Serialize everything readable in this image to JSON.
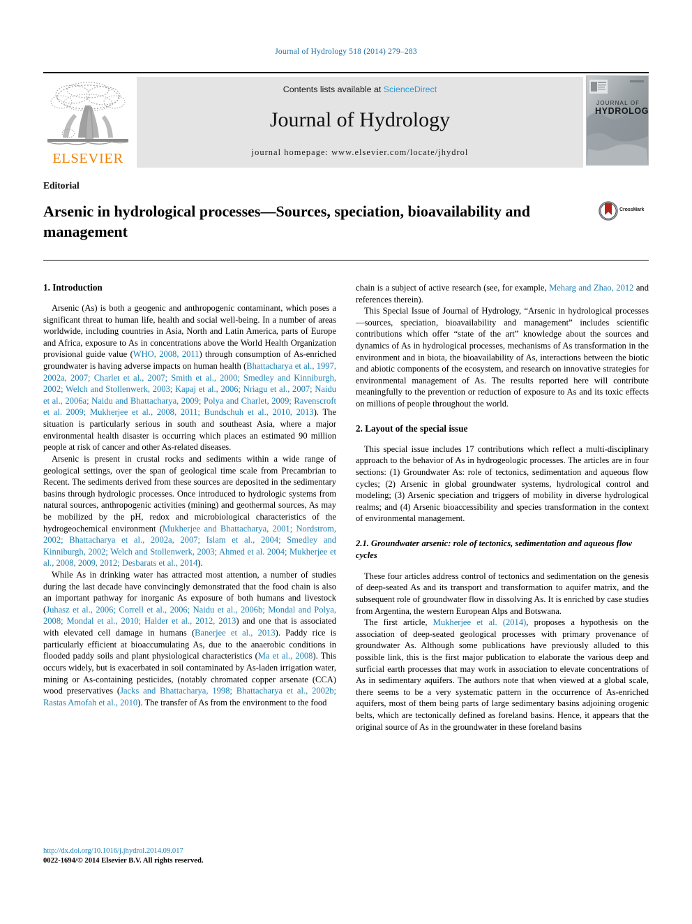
{
  "running_head": "Journal of Hydrology 518 (2014) 279–283",
  "masthead": {
    "publisher_name": "ELSEVIER",
    "publisher_logo_alt": "elsevier-tree-logo",
    "contents_prefix": "Contents lists available at ",
    "contents_link": "ScienceDirect",
    "journal_title": "Journal of Hydrology",
    "homepage_line": "journal homepage: www.elsevier.com/locate/jhydrol",
    "cover_title_line1": "JOURNAL OF",
    "cover_title_line2": "HYDROLOGY"
  },
  "article": {
    "kicker": "Editorial",
    "title": "Arsenic in hydrological processes—Sources, speciation, bioavailability and management",
    "crossmark_label": "CrossMark"
  },
  "left_column": {
    "section1_heading": "1. Introduction",
    "p1_a": "Arsenic (As) is both a geogenic and anthropogenic contaminant, which poses a significant threat to human life, health and social well-being. In a number of areas worldwide, including countries in Asia, North and Latin America, parts of Europe and Africa, exposure to As in concentrations above the World Health Organization provisional guide value (",
    "p1_ref1": "WHO, 2008, 2011",
    "p1_b": ") through consumption of As-enriched groundwater is having adverse impacts on human health (",
    "p1_ref2": "Bhattacharya et al., 1997, 2002a, 2007; Charlet et al., 2007; Smith et al., 2000; Smedley and Kinniburgh, 2002; Welch and Stollenwerk, 2003; Kapaj et al., 2006; Nriagu et al., 2007; Naidu et al., 2006a; Naidu and Bhattacharya, 2009; Polya and Charlet, 2009; Ravenscroft et al. 2009; Mukherjee et al., 2008, 2011; Bundschuh et al., 2010, 2013",
    "p1_c": "). The situation is particularly serious in south and southeast Asia, where a major environmental health disaster is occurring which places an estimated 90 million people at risk of cancer and other As-related diseases.",
    "p2_a": "Arsenic is present in crustal rocks and sediments within a wide range of geological settings, over the span of geological time scale from Precambrian to Recent. The sediments derived from these sources are deposited in the sedimentary basins through hydrologic processes. Once introduced to hydrologic systems from natural sources, anthropogenic activities (mining) and geothermal sources, As may be mobilized by the pH, redox and microbiological characteristics of the hydrogeochemical environment (",
    "p2_ref1": "Mukherjee and Bhattacharya, 2001; Nordstrom, 2002; Bhattacharya et al., 2002a, 2007; Islam et al., 2004; Smedley and Kinniburgh, 2002; Welch and Stollenwerk, 2003; Ahmed et al. 2004; Mukherjee et al., 2008, 2009, 2012; Desbarats et al., 2014",
    "p2_b": ").",
    "p3_a": "While As in drinking water has attracted most attention, a number of studies during the last decade have convincingly demonstrated that the food chain is also an important pathway for inorganic As exposure of both humans and livestock (",
    "p3_ref1": "Juhasz et al., 2006; Correll et al., 2006; Naidu et al., 2006b; Mondal and Polya, 2008; Mondal et al., 2010; Halder et al., 2012, 2013",
    "p3_b": ") and one that is associated with elevated cell damage in humans (",
    "p3_ref2": "Banerjee et al., 2013",
    "p3_c": "). Paddy rice is particularly efficient at bioaccumulating As, due to the anaerobic conditions in flooded paddy soils and plant physiological characteristics (",
    "p3_ref3": "Ma et al., 2008",
    "p3_d": "). This occurs widely, but is exacerbated in soil contaminated by As-laden irrigation water, mining or As-containing pesticides, (notably chromated copper arsenate (CCA) wood preservatives (",
    "p3_ref4": "Jacks and Bhattacharya, 1998; Bhattacharya et al., 2002b; Rastas Amofah et al., 2010",
    "p3_e": "). The transfer of As from the environment to the food"
  },
  "right_column": {
    "p1_a": "chain is a subject of active research (see, for example, ",
    "p1_ref1": "Meharg and Zhao, 2012",
    "p1_b": " and references therein).",
    "p2": "This Special Issue of Journal of Hydrology, “Arsenic in hydrological processes—sources, speciation, bioavailability and management” includes scientific contributions which offer “state of the art” knowledge about the sources and dynamics of As in hydrological processes, mechanisms of As transformation in the environment and in biota, the bioavailability of As, interactions between the biotic and abiotic components of the ecosystem, and research on innovative strategies for environmental management of As. The results reported here will contribute meaningfully to the prevention or reduction of exposure to As and its toxic effects on millions of people throughout the world.",
    "section2_heading": "2. Layout of the special issue",
    "p3": "This special issue includes 17 contributions which reflect a multi-disciplinary approach to the behavior of As in hydrogeologic processes. The articles are in four sections: (1) Groundwater As: role of tectonics, sedimentation and aqueous flow cycles; (2) Arsenic in global groundwater systems, hydrological control and modeling; (3) Arsenic speciation and triggers of mobility in diverse hydrological realms; and (4) Arsenic bioaccessibility and species transformation in the context of environmental management.",
    "subsection21_heading": "2.1. Groundwater arsenic: role of tectonics, sedimentation and aqueous flow cycles",
    "p4": "These four articles address control of tectonics and sedimentation on the genesis of deep-seated As and its transport and transformation to aquifer matrix, and the subsequent role of groundwater flow in dissolving As. It is enriched by case studies from Argentina, the western European Alps and Botswana.",
    "p5_a": "The first article, ",
    "p5_ref1": "Mukherjee et al. (2014)",
    "p5_b": ", proposes a hypothesis on the association of deep-seated geological processes with primary provenance of groundwater As. Although some publications have previously alluded to this possible link, this is the first major publication to elaborate the various deep and surficial earth processes that may work in association to elevate concentrations of As in sedimentary aquifers. The authors note that when viewed at a global scale, there seems to be a very systematic pattern in the occurrence of As-enriched aquifers, most of them being parts of large sedimentary basins adjoining orogenic belts, which are tectonically defined as foreland basins. Hence, it appears that the original source of As in the groundwater in these foreland basins"
  },
  "footer": {
    "doi": "http://dx.doi.org/10.1016/j.jhydrol.2014.09.017",
    "copyright": "0022-1694/© 2014 Elsevier B.V. All rights reserved."
  },
  "colors": {
    "link_blue": "#1a7fb5",
    "sciencedirect_blue": "#2a9ad6",
    "elsevier_orange": "#f28100",
    "panel_grey": "#e4e4e4",
    "crossmark_red": "#b5241c"
  }
}
